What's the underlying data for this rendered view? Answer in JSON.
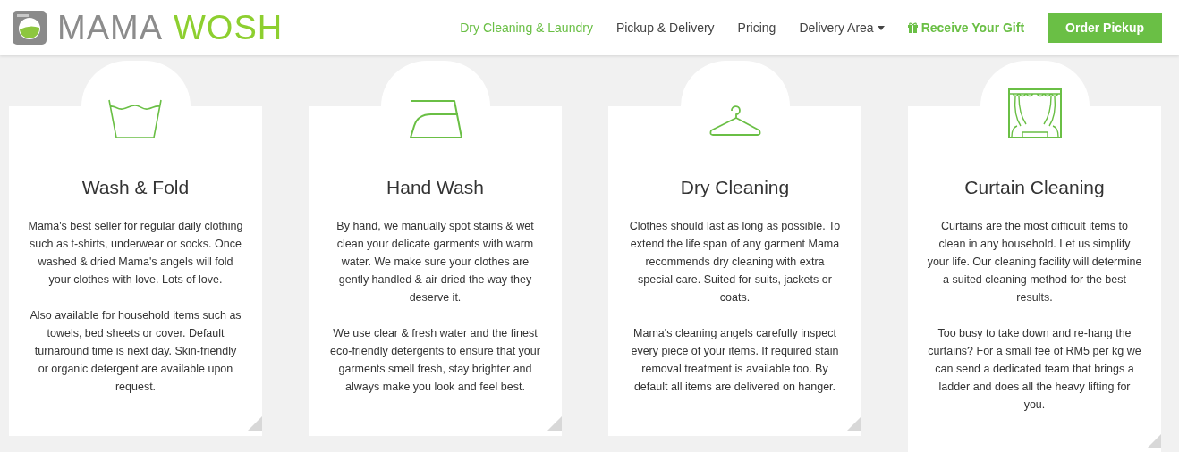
{
  "header": {
    "logo": {
      "word_1": "MAMA",
      "word_2": "WOSH"
    },
    "nav": [
      {
        "label": "Dry Cleaning & Laundry",
        "kind": "link",
        "selected": true
      },
      {
        "label": "Pickup & Delivery",
        "kind": "link",
        "selected": false
      },
      {
        "label": "Pricing",
        "kind": "link",
        "selected": false
      },
      {
        "label": "Delivery Area",
        "kind": "dropdown",
        "selected": false
      },
      {
        "label": "Receive Your Gift",
        "kind": "gift",
        "selected": false
      },
      {
        "label": "Order Pickup",
        "kind": "button",
        "selected": false
      }
    ]
  },
  "services": [
    {
      "kind": "wash",
      "title": "Wash & Fold",
      "paragraphs": [
        "Mama's best seller for regular daily clothing such as t-shirts, underwear or socks. Once washed & dried Mama's angels will fold your clothes with love. Lots of love.",
        "Also available for household items such as towels, bed sheets or cover. Default turnaround time is next day. Skin-friendly or organic detergent are available upon request."
      ]
    },
    {
      "kind": "iron",
      "title": "Hand Wash",
      "paragraphs": [
        "By hand, we manually spot stains & wet clean your delicate garments with warm water. We make sure your clothes are gently handled & air dried the way they deserve it.",
        "We use clear & fresh water and the finest eco-friendly detergents to ensure that your garments smell fresh, stay brighter and always make you look and feel best."
      ]
    },
    {
      "kind": "hanger",
      "title": "Dry Cleaning",
      "paragraphs": [
        "Clothes should last as long as possible. To extend the life span of any garment Mama recommends dry cleaning with extra special care. Suited for suits, jackets or coats.",
        "Mama's cleaning angels carefully inspect every piece of your items. If required stain removal treatment is available too. By default all items are delivered on hanger."
      ]
    },
    {
      "kind": "curtain",
      "title": "Curtain Cleaning",
      "paragraphs": [
        "Curtains are the most difficult items to clean in any household. Let us simplify your life. Our cleaning facility will determine a suited cleaning method for the best results.",
        "Too busy to take down and re-hang the curtains? For a small fee of RM5 per kg we can send a dedicated team that brings a ladder and does all the heavy lifting for you."
      ]
    }
  ]
}
